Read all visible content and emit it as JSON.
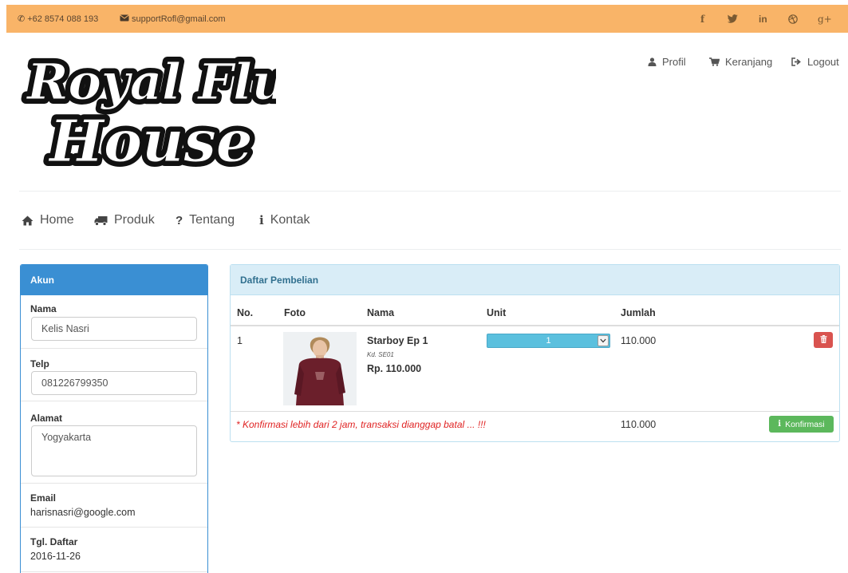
{
  "topbar": {
    "phone": "+62 8574 088 193",
    "email": "supportRofl@gmail.com",
    "phone_icon": "phone-icon",
    "mail_icon": "envelope-icon",
    "bg_color": "#f9b468",
    "social": {
      "facebook": "f",
      "linkedin": "in",
      "googleplus": "g+"
    }
  },
  "logo": {
    "text": "Royal Flush House"
  },
  "usernav": {
    "profil": "Profil",
    "keranjang": "Keranjang",
    "logout": "Logout"
  },
  "mainnav": {
    "home": "Home",
    "produk": "Produk",
    "tentang": "Tentang",
    "kontak": "Kontak"
  },
  "akun": {
    "title": "Akun",
    "header_color": "#3a8fd3",
    "nama_label": "Nama",
    "nama_value": "Kelis Nasri",
    "telp_label": "Telp",
    "telp_value": "081226799350",
    "alamat_label": "Alamat",
    "alamat_value": "Yogyakarta",
    "email_label": "Email",
    "email_value": "harisnasri@google.com",
    "tgl_label": "Tgl. Daftar",
    "tgl_value": "2016-11-26"
  },
  "pembelian": {
    "title": "Daftar Pembelian",
    "header_color": "#d9edf7",
    "columns": {
      "no": "No.",
      "foto": "Foto",
      "nama": "Nama",
      "unit": "Unit",
      "jumlah": "Jumlah"
    },
    "items": [
      {
        "no": "1",
        "name": "Starboy Ep 1",
        "code": "Kd. SE01",
        "price": "Rp. 110.000",
        "unit": "1",
        "jumlah": "110.000"
      }
    ],
    "warning": "* Konfirmasi lebih dari 2 jam, transaksi dianggap batal ... !!!",
    "warning_color": "#e02424",
    "total": "110.000",
    "confirm_label": "Konfirmasi",
    "delete_color": "#d9534f",
    "confirm_color": "#5cb85c",
    "unit_select_color": "#5bc0de"
  }
}
